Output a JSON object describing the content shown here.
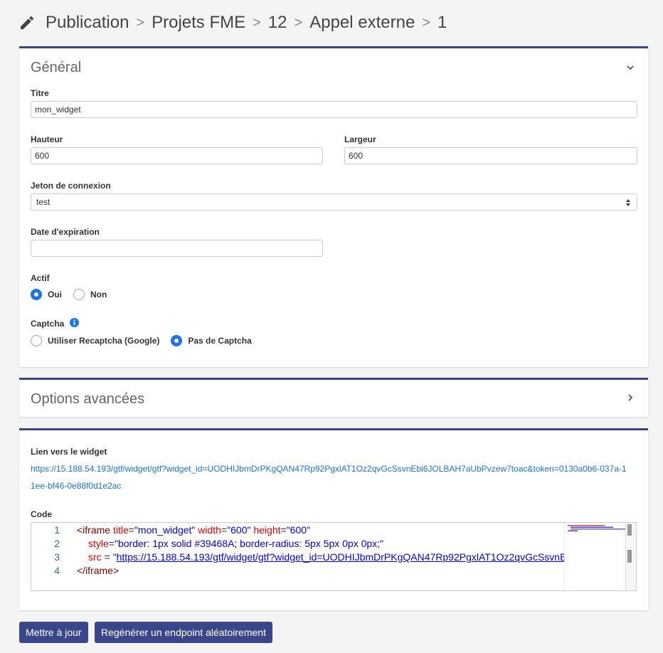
{
  "breadcrumb": {
    "items": [
      "Publication",
      "Projets FME",
      "12",
      "Appel externe",
      "1"
    ],
    "separator": ">"
  },
  "general": {
    "title": "Général",
    "titre_label": "Titre",
    "titre_value": "mon_widget",
    "hauteur_label": "Hauteur",
    "hauteur_value": "600",
    "largeur_label": "Largeur",
    "largeur_value": "600",
    "jeton_label": "Jeton de connexion",
    "jeton_value": "test",
    "date_label": "Date d'expiration",
    "date_value": "",
    "actif_label": "Actif",
    "actif_options": [
      "Oui",
      "Non"
    ],
    "actif_selected": "Oui",
    "captcha_label": "Captcha",
    "captcha_options": [
      "Utiliser Recaptcha (Google)",
      "Pas de Captcha"
    ],
    "captcha_selected": "Pas de Captcha"
  },
  "advanced": {
    "title": "Options avancées"
  },
  "widget": {
    "link_label": "Lien vers le widget",
    "link_url": "https://15.188.54.193/gtf/widget/gtf?widget_id=UODHIJbmDrPKgQAN47Rp92PgxlAT1Oz2qvGcSsvnEbi6JOLBAH7aUbPvzew7toac&token=0130a0b6-037a-11ee-bf46-0e88f0d1e2ac",
    "code_label": "Code",
    "code_lines": {
      "l1_num": "1",
      "l2_num": "2",
      "l3_num": "3",
      "l4_num": "4",
      "l1_open": "<iframe",
      "l1_title_attr": "title",
      "l1_title_val": "\"mon_widget\"",
      "l1_width_attr": "width",
      "l1_width_val": "\"600\"",
      "l1_height_attr": "height",
      "l1_height_val": "\"600\"",
      "l2_style_attr": "style",
      "l2_style_val": "\"border: 1px solid #39468A; border-radius: 5px 5px 0px 0px;\"",
      "l3_src_attr": "src",
      "l3_eq": " = ",
      "l3_quote": "\"",
      "l3_src_val": "https://15.188.54.193/gtf/widget/gtf?widget_id=UODHIJbmDrPKgQAN47Rp92PgxlAT1Oz2qvGcSsvnE",
      "l4_close": "</iframe>"
    }
  },
  "buttons": {
    "update": "Mettre à jour",
    "regenerate": "Regénérer un endpoint aléatoirement"
  },
  "colors": {
    "accent": "#39468A",
    "link": "#1a73e8"
  }
}
